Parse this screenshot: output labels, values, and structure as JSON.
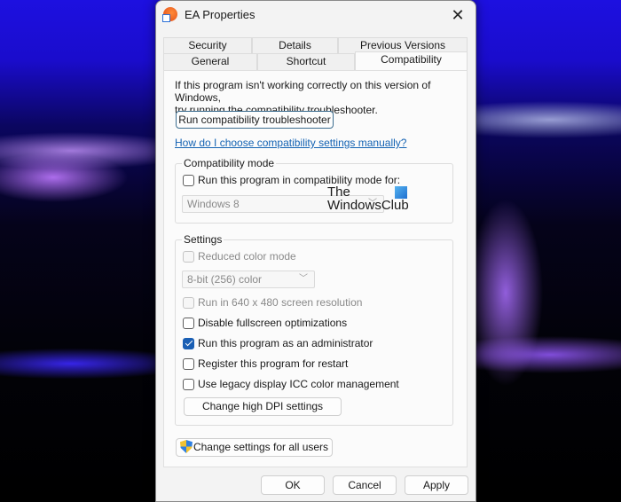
{
  "window": {
    "title": "EA Properties",
    "close_icon": "close-icon",
    "app_icon": "ea-app-icon"
  },
  "tabs": {
    "row_top": [
      {
        "label": "Security"
      },
      {
        "label": "Details"
      },
      {
        "label": "Previous Versions"
      }
    ],
    "row_bottom": [
      {
        "label": "General"
      },
      {
        "label": "Shortcut"
      },
      {
        "label": "Compatibility",
        "active": true
      }
    ]
  },
  "compatibility": {
    "intro_line1": "If this program isn't working correctly on this version of Windows,",
    "intro_line2": "try running the compatibility troubleshooter.",
    "troubleshooter_button": "Run compatibility troubleshooter",
    "help_link": "How do I choose compatibility settings manually?",
    "mode_group": {
      "label": "Compatibility mode",
      "checkbox_label": "Run this program in compatibility mode for:",
      "checked": false,
      "os_select_value": "Windows 8"
    },
    "settings_group": {
      "label": "Settings",
      "reduced_color": {
        "label": "Reduced color mode",
        "checked": false,
        "disabled": true
      },
      "color_select_value": "8-bit (256) color",
      "run_640": {
        "label": "Run in 640 x 480 screen resolution",
        "checked": false,
        "disabled": true
      },
      "disable_fullscreen": {
        "label": "Disable fullscreen optimizations",
        "checked": false
      },
      "run_as_admin": {
        "label": "Run this program as an administrator",
        "checked": true
      },
      "register_restart": {
        "label": "Register this program for restart",
        "checked": false
      },
      "legacy_icc": {
        "label": "Use legacy display ICC color management",
        "checked": false
      },
      "dpi_button": "Change high DPI settings"
    },
    "all_users_button": "Change settings for all users"
  },
  "watermark": {
    "line1": "The",
    "line2": "WindowsClub"
  },
  "footer": {
    "ok": "OK",
    "cancel": "Cancel",
    "apply": "Apply"
  },
  "colors": {
    "accent": "#1a5fb4",
    "link": "#1463b3"
  }
}
